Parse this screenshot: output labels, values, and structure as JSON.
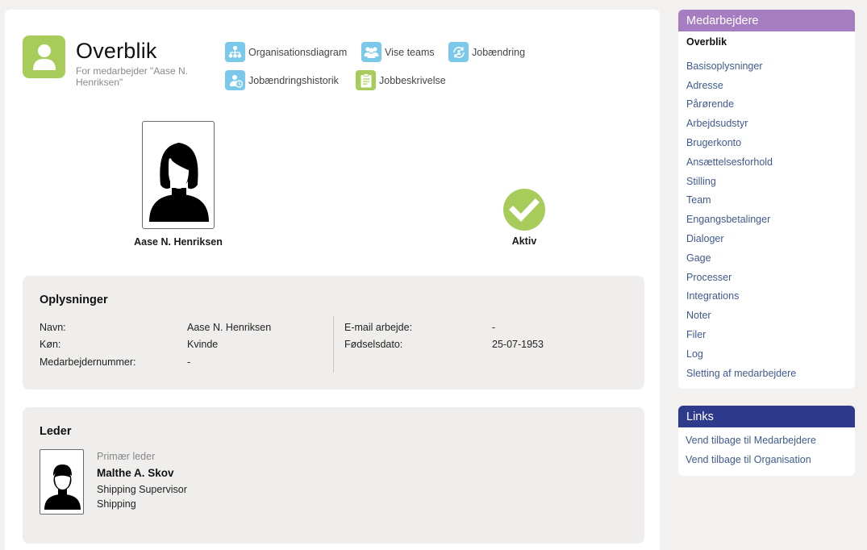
{
  "header": {
    "title": "Overblik",
    "subtitle": "For medarbejder \"Aase N. Henriksen\""
  },
  "toolbar": [
    {
      "label": "Organisationsdiagram",
      "icon": "org-chart-icon",
      "color": "#7bc9ea"
    },
    {
      "label": "Vise teams",
      "icon": "team-icon",
      "color": "#7bc9ea"
    },
    {
      "label": "Jobændring",
      "icon": "job-change-icon",
      "color": "#7bc9ea"
    },
    {
      "label": "Jobændringshistorik",
      "icon": "job-history-icon",
      "color": "#7bc9ea"
    },
    {
      "label": "Jobbeskrivelse",
      "icon": "clipboard-icon",
      "color": "#a8cc5a"
    }
  ],
  "employee": {
    "name": "Aase N. Henriksen",
    "status": "Aktiv",
    "status_color": "#a8cc5a"
  },
  "info": {
    "title": "Oplysninger",
    "left": [
      {
        "label": "Navn:",
        "value": "Aase N. Henriksen"
      },
      {
        "label": "Køn:",
        "value": "Kvinde"
      },
      {
        "label": "Medarbejdernummer:",
        "value": "-"
      }
    ],
    "right": [
      {
        "label": "E-mail arbejde:",
        "value": "-"
      },
      {
        "label": "Fødselsdato:",
        "value": "25-07-1953"
      }
    ]
  },
  "manager": {
    "title": "Leder",
    "role": "Primær leder",
    "name": "Malthe A. Skov",
    "position": "Shipping Supervisor",
    "department": "Shipping"
  },
  "sidebar": {
    "title": "Medarbejdere",
    "color": "#a57dc0",
    "items": [
      {
        "label": "Overblik",
        "active": true
      },
      {
        "label": "Basisoplysninger"
      },
      {
        "label": "Adresse"
      },
      {
        "label": "Pårørende"
      },
      {
        "label": "Arbejdsudstyr"
      },
      {
        "label": "Brugerkonto"
      },
      {
        "label": "Ansættelsesforhold"
      },
      {
        "label": "Stilling"
      },
      {
        "label": "Team"
      },
      {
        "label": "Engangsbetalinger"
      },
      {
        "label": "Dialoger"
      },
      {
        "label": "Gage"
      },
      {
        "label": "Processer"
      },
      {
        "label": "Integrations"
      },
      {
        "label": "Noter"
      },
      {
        "label": "Filer"
      },
      {
        "label": "Log"
      },
      {
        "label": "Sletting af medarbejdere"
      }
    ]
  },
  "links": {
    "title": "Links",
    "color": "#2e3a8c",
    "items": [
      {
        "label": "Vend tilbage til Medarbejdere"
      },
      {
        "label": "Vend tilbage til Organisation"
      }
    ]
  }
}
